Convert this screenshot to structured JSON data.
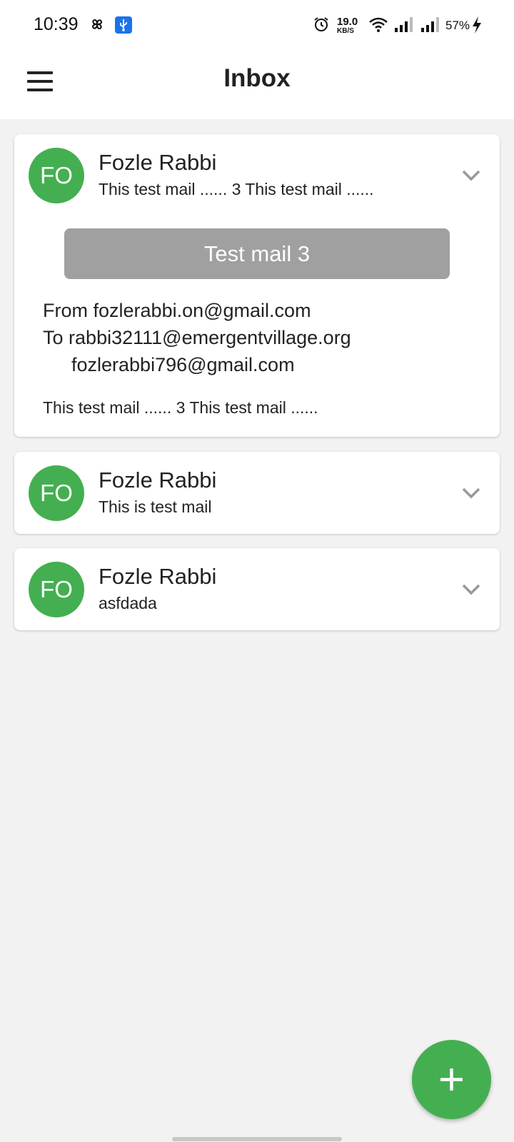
{
  "status_bar": {
    "time": "10:39",
    "net_speed_value": "19.0",
    "net_speed_unit": "KB/S",
    "battery": "57%",
    "icons": [
      "pinwheel-icon",
      "usb-icon",
      "alarm-icon",
      "wifi-icon",
      "signal-icon",
      "signal-icon",
      "charging-icon"
    ]
  },
  "app_bar": {
    "title": "Inbox",
    "menu_icon": "hamburger-menu-icon"
  },
  "emails": [
    {
      "avatar": "FO",
      "sender": "Fozle Rabbi",
      "preview": "This test mail ...... 3 This test mail ......",
      "expanded": true,
      "subject": "Test mail 3",
      "from_label": "From",
      "from": "fozlerabbi.on@gmail.com",
      "to_label": "To",
      "to": [
        "rabbi32111@emergentvillage.org",
        "fozlerabbi796@gmail.com"
      ],
      "body": "This test mail ...... 3 This test mail ......"
    },
    {
      "avatar": "FO",
      "sender": "Fozle Rabbi",
      "preview": "This is test mail",
      "expanded": false
    },
    {
      "avatar": "FO",
      "sender": "Fozle Rabbi",
      "preview": "asfdada",
      "expanded": false
    }
  ],
  "fab": {
    "icon": "plus-icon"
  },
  "colors": {
    "accent": "#44af50",
    "subject_bg": "#a0a0a0",
    "background": "#f2f2f2"
  }
}
